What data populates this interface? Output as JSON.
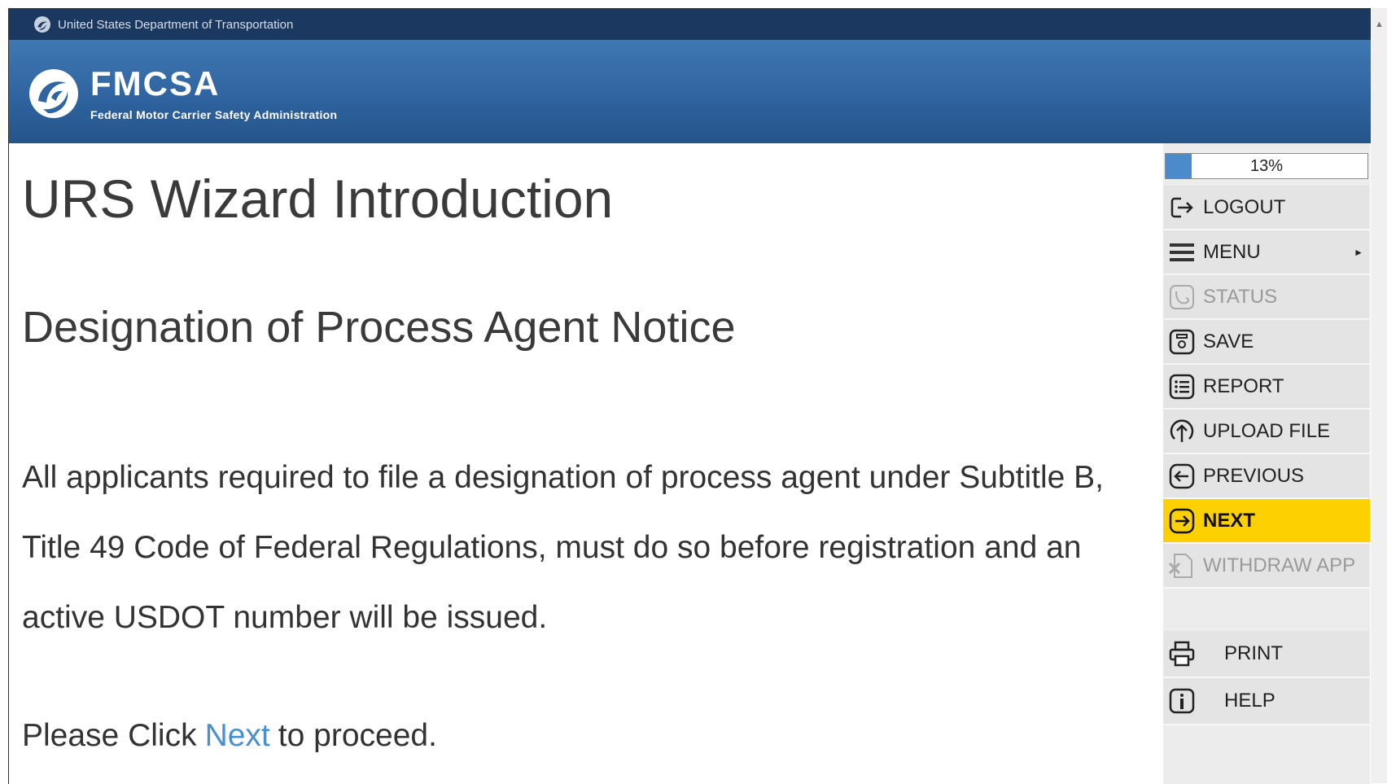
{
  "dot_bar": {
    "text": "United States Department of Transportation"
  },
  "header": {
    "title": "FMCSA",
    "subtitle": "Federal Motor Carrier Safety Administration"
  },
  "content": {
    "title": "URS Wizard Introduction",
    "subtitle": "Designation of Process Agent Notice",
    "body": "All applicants required to file a designation of process agent under Subtitle B, Title 49 Code of Federal Regulations, must do so before registration and an active USDOT number will be issued.",
    "proceed_before": "Please Click",
    "proceed_link": "Next",
    "proceed_after": "to proceed."
  },
  "progress": {
    "value": 0.13,
    "label": "13%"
  },
  "sidebar": {
    "items": [
      {
        "label": "LOGOUT",
        "icon": "logout-icon",
        "state": "enabled"
      },
      {
        "label": "MENU",
        "icon": "menu-icon",
        "state": "enabled"
      },
      {
        "label": "STATUS",
        "icon": "status-icon",
        "state": "disabled"
      },
      {
        "label": "SAVE",
        "icon": "save-icon",
        "state": "enabled"
      },
      {
        "label": "REPORT",
        "icon": "report-icon",
        "state": "enabled"
      },
      {
        "label": "UPLOAD FILE",
        "icon": "upload-icon",
        "state": "enabled"
      },
      {
        "label": "PREVIOUS",
        "icon": "previous-icon",
        "state": "enabled"
      },
      {
        "label": "NEXT",
        "icon": "next-icon",
        "state": "active"
      },
      {
        "label": "WITHDRAW APP",
        "icon": "withdraw-icon",
        "state": "disabled"
      }
    ],
    "print_label": "PRINT",
    "help_label": "HELP"
  },
  "colors": {
    "header_blue": "#2f64a0",
    "dot_bar": "#1a3860",
    "active_yellow": "#fdd001",
    "link_blue": "#4a8fcf",
    "progress_fill": "#4b8acb"
  }
}
